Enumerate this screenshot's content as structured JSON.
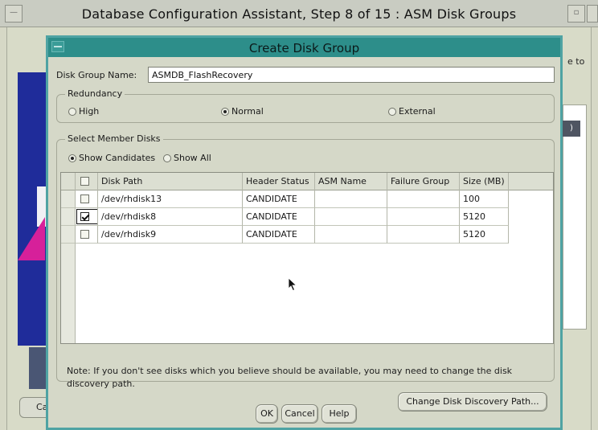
{
  "outer_window": {
    "title": "Database Configuration Assistant, Step 8 of 15 : ASM Disk Groups",
    "partial_text_right": "e to",
    "partial_panel_text": ")",
    "cancel_partial_label": "Ca"
  },
  "dialog": {
    "title": "Create Disk Group",
    "disk_group_name_label": "Disk Group Name:",
    "disk_group_name_value": "ASMDB_FlashRecovery",
    "redundancy": {
      "legend": "Redundancy",
      "options": [
        {
          "label": "High",
          "selected": false
        },
        {
          "label": "Normal",
          "selected": true
        },
        {
          "label": "External",
          "selected": false
        }
      ]
    },
    "member_disks": {
      "legend": "Select Member Disks",
      "filter_options": [
        {
          "label": "Show Candidates",
          "selected": true
        },
        {
          "label": "Show All",
          "selected": false
        }
      ],
      "columns": [
        "Disk Path",
        "Header Status",
        "ASM Name",
        "Failure Group",
        "Size (MB)"
      ],
      "rows": [
        {
          "checked": false,
          "disk_path": "/dev/rhdisk13",
          "header_status": "CANDIDATE",
          "asm_name": "",
          "failure_group": "",
          "size_mb": "100"
        },
        {
          "checked": true,
          "disk_path": "/dev/rhdisk8",
          "header_status": "CANDIDATE",
          "asm_name": "",
          "failure_group": "",
          "size_mb": "5120"
        },
        {
          "checked": false,
          "disk_path": "/dev/rhdisk9",
          "header_status": "CANDIDATE",
          "asm_name": "",
          "failure_group": "",
          "size_mb": "5120"
        }
      ],
      "note": "Note: If you don't see disks which you believe should be available, you may need to change the disk discovery path.",
      "change_path_label": "Change Disk Discovery Path..."
    },
    "buttons": {
      "ok": "OK",
      "cancel": "Cancel",
      "help": "Help"
    }
  },
  "colors": {
    "dialog_title_bar": "#2d8e8a",
    "dialog_background": "#d5d8c8",
    "art_blue": "#1f2c9a",
    "art_magenta": "#d6209a"
  }
}
